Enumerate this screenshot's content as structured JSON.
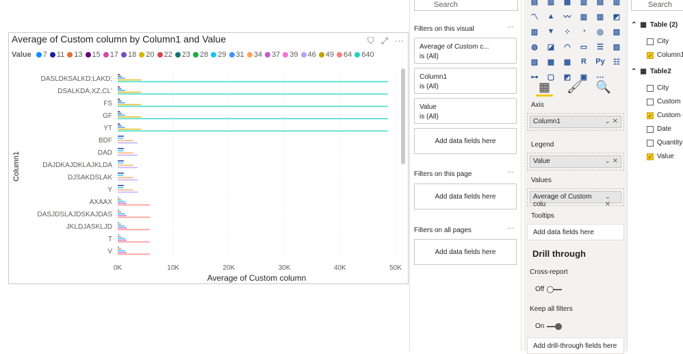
{
  "visual": {
    "title": "Average of Custom column by Column1 and Value",
    "legend_title": "Value"
  },
  "chart_data": {
    "type": "bar",
    "orientation": "horizontal",
    "title": "Average of Custom column by Column1 and Value",
    "xlabel": "Average of Custom column",
    "ylabel": "Column1",
    "xlim": [
      0,
      50000
    ],
    "xticks": [
      "0K",
      "10K",
      "20K",
      "30K",
      "40K",
      "50K"
    ],
    "xtick_values": [
      0,
      10000,
      20000,
      30000,
      40000,
      50000
    ],
    "grid": "vertical dotted",
    "legend_placement": "top-left",
    "legend": [
      {
        "name": "7",
        "color": "#118DFF"
      },
      {
        "name": "11",
        "color": "#12239E"
      },
      {
        "name": "13",
        "color": "#E66C37"
      },
      {
        "name": "15",
        "color": "#6B007B"
      },
      {
        "name": "17",
        "color": "#E044A7"
      },
      {
        "name": "18",
        "color": "#744EC2"
      },
      {
        "name": "20",
        "color": "#D9B300"
      },
      {
        "name": "22",
        "color": "#D64550"
      },
      {
        "name": "23",
        "color": "#197278"
      },
      {
        "name": "28",
        "color": "#1AAB40"
      },
      {
        "name": "29",
        "color": "#15C6F4"
      },
      {
        "name": "31",
        "color": "#4092FF"
      },
      {
        "name": "34",
        "color": "#FFA058"
      },
      {
        "name": "37",
        "color": "#BE5DC9"
      },
      {
        "name": "39",
        "color": "#F472D0"
      },
      {
        "name": "46",
        "color": "#B5A1FF"
      },
      {
        "name": "49",
        "color": "#C4A200"
      },
      {
        "name": "64",
        "color": "#FD817E"
      },
      {
        "name": "640",
        "color": "#1DD5C2"
      }
    ],
    "categories": [
      "DASLDKSALKD;LAKD;",
      "DSALKDA,XZ,CL'",
      "FS",
      "GF",
      "YT",
      "BDF",
      "DAD",
      "DAJDKAJDKLAJKLDA",
      "DJSAKDSLAK",
      "Y",
      "AXAAX",
      "DASJDSLAJDSKAJDAS",
      "JKLDJASKLJD",
      "T",
      "V"
    ],
    "groups": [
      {
        "categories": [
          "DASLDKSALKD;LAKD;",
          "DSALKDA,XZ,CL'",
          "FS",
          "GF",
          "YT"
        ],
        "bars": [
          {
            "series": "15",
            "value": 400
          },
          {
            "series": "23",
            "value": 700
          },
          {
            "series": "31",
            "value": 1300
          },
          {
            "series": "20",
            "value": 4200
          },
          {
            "series": "640",
            "value": 48600
          }
        ]
      },
      {
        "categories": [
          "BDF",
          "DAD",
          "DAJDKAJDKLAJKLDA",
          "DJSAKDSLAK",
          "Y"
        ],
        "bars": [
          {
            "series": "11",
            "value": 1100
          },
          {
            "series": "29",
            "value": 1000
          },
          {
            "series": "34",
            "value": 2800
          },
          {
            "series": "46",
            "value": 3600
          }
        ]
      },
      {
        "categories": [
          "AXAAX",
          "DASJDSLAJDSKAJDAS",
          "JKLDJASKLJD",
          "T",
          "V"
        ],
        "bars": [
          {
            "series": "7",
            "value": 250
          },
          {
            "series": "13",
            "value": 600
          },
          {
            "series": "29",
            "value": 1300
          },
          {
            "series": "37",
            "value": 1600
          },
          {
            "series": "64",
            "value": 5800
          }
        ]
      }
    ]
  },
  "filters": {
    "search": "Search",
    "on_visual": "Filters on this visual",
    "cards": [
      {
        "name": "Average of Custom c...",
        "value": "is (All)"
      },
      {
        "name": "Column1",
        "value": "is (All)"
      },
      {
        "name": "Value",
        "value": "is (All)"
      }
    ],
    "add": "Add data fields here",
    "on_page": "Filters on this page",
    "on_all": "Filters on all pages",
    "more": "···"
  },
  "viz": {
    "axis": "Axis",
    "axis_field": "Column1",
    "legend": "Legend",
    "legend_field": "Value",
    "values": "Values",
    "values_field": "Average of Custom colu",
    "tooltips": "Tooltips",
    "add": "Add data fields here",
    "drill": "Drill through",
    "cross": "Cross-report",
    "off": "Off",
    "keep": "Keep all filters",
    "on": "On",
    "add_drill": "Add drill-through fields here"
  },
  "fields": {
    "search": "Search",
    "tables": [
      {
        "name": "Table (2)",
        "fields": [
          {
            "name": "City",
            "checked": false
          },
          {
            "name": "Column1",
            "checked": true
          }
        ]
      },
      {
        "name": "Table2",
        "fields": [
          {
            "name": "City",
            "checked": false
          },
          {
            "name": "Custom",
            "checked": false
          },
          {
            "name": "Custom column",
            "checked": true
          },
          {
            "name": "Date",
            "checked": false
          },
          {
            "name": "Quantity",
            "checked": false
          },
          {
            "name": "Value",
            "checked": true
          }
        ]
      }
    ]
  }
}
